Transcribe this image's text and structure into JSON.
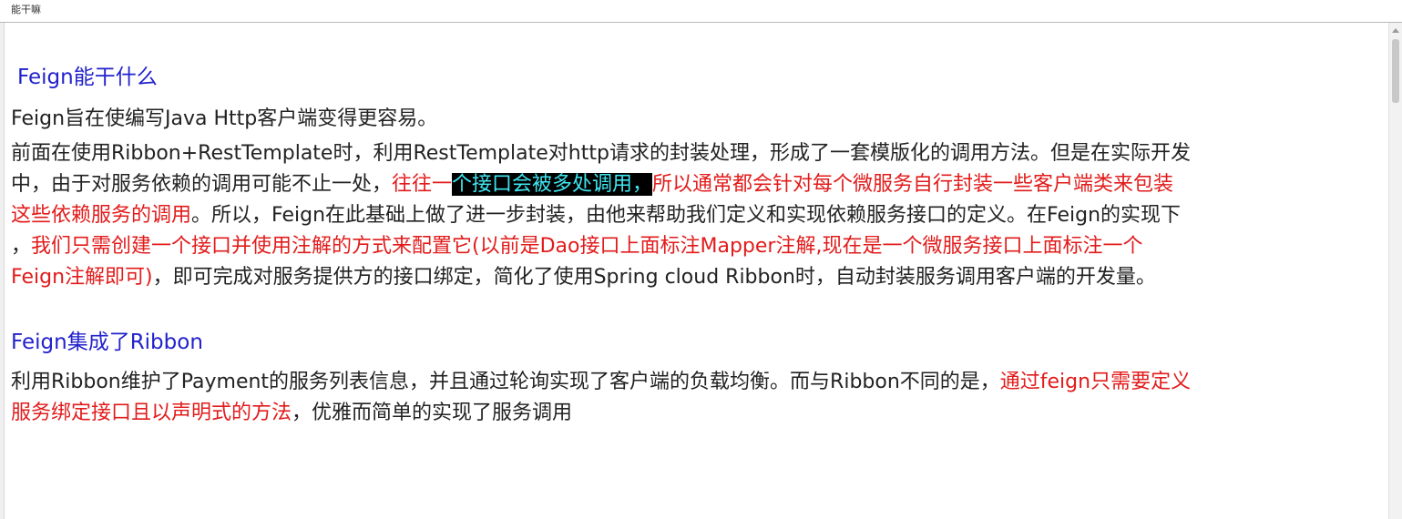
{
  "window": {
    "title": "能干嘛"
  },
  "colors": {
    "heading": "#2222cc",
    "text": "#222222",
    "emphasis": "#e21b1b",
    "highlight_bg": "#000000",
    "highlight_fg": "#40e6f0"
  },
  "doc": {
    "heading1": "Feign能干什么",
    "para1": "Feign旨在使编写Java Http客户端变得更容易。",
    "para2": {
      "line1": "前面在使用Ribbon+RestTemplate时，利用RestTemplate对http请求的封装处理，形成了一套模版化的调用方法。但是在实际开发",
      "line2_a": "中，由于对服务依赖的调用可能不止一处，",
      "line2_b": "往往一",
      "line2_c": "个接口会被多处调用，",
      "line2_d": "所以通常都会针对每个微服务自行封装一些客户端类来包装",
      "line3_a": "这些依赖服务的调用",
      "line3_b": "。所以，Feign在此基础上做了进一步封装，由他来帮助我们定义和实现依赖服务接口的定义。在Feign的实现下",
      "line4_a": "，",
      "line4_b": "我们只需创建一个接口并使用注解的方式来配置它(以前是Dao接口上面标注Mapper注解,现在是一个微服务接口上面标注一个",
      "line5_a": "Feign注解即可)",
      "line5_b": "，即可完成对服务提供方的接口绑定，简化了使用Spring cloud Ribbon时，自动封装服务调用客户端的开发量。"
    },
    "heading2": "Feign集成了Ribbon",
    "para3": {
      "line1_a": "利用Ribbon维护了Payment的服务列表信息，并且通过轮询实现了客户端的负载均衡。而与Ribbon不同的是，",
      "line1_b": "通过feign只需要定义",
      "line2_a": "服务绑定接口且以声明式的方法",
      "line2_b": "，优雅而简单的实现了服务调用"
    }
  }
}
